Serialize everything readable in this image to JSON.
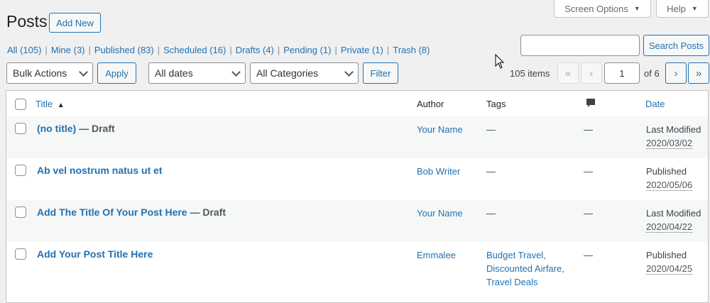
{
  "header": {
    "screen_options": "Screen Options",
    "help": "Help",
    "title": "Posts",
    "add_new": "Add New"
  },
  "filters": {
    "views": [
      {
        "label": "All",
        "count": "(105)"
      },
      {
        "label": "Mine",
        "count": "(3)"
      },
      {
        "label": "Published",
        "count": "(83)"
      },
      {
        "label": "Scheduled",
        "count": "(16)"
      },
      {
        "label": "Drafts",
        "count": "(4)"
      },
      {
        "label": "Pending",
        "count": "(1)"
      },
      {
        "label": "Private",
        "count": "(1)"
      },
      {
        "label": "Trash",
        "count": "(8)"
      }
    ],
    "bulk_actions": "Bulk Actions",
    "apply": "Apply",
    "dates": "All dates",
    "categories": "All Categories",
    "filter": "Filter"
  },
  "search": {
    "value": "",
    "button": "Search Posts"
  },
  "pagination": {
    "items": "105 items",
    "first": "«",
    "prev": "‹",
    "current": "1",
    "of": "of 6",
    "next": "›",
    "last": "»"
  },
  "table": {
    "columns": {
      "title": "Title",
      "sort_indicator": "▲",
      "author": "Author",
      "tags": "Tags",
      "date": "Date"
    },
    "icons": {
      "comments": "comment-bubble-icon"
    },
    "rows": [
      {
        "title": "(no title)",
        "state": " — Draft",
        "author": "Your Name",
        "tags": [
          "—"
        ],
        "comments": "—",
        "status": "Last Modified",
        "date": "2020/03/02"
      },
      {
        "title": "Ab vel nostrum natus ut et",
        "state": "",
        "author": "Bob Writer",
        "tags": [
          "—"
        ],
        "comments": "—",
        "status": "Published",
        "date": "2020/05/06"
      },
      {
        "title": "Add The Title Of Your Post Here",
        "state": " — Draft",
        "author": "Your Name",
        "tags": [
          "—"
        ],
        "comments": "—",
        "status": "Last Modified",
        "date": "2020/04/22"
      },
      {
        "title": "Add Your Post Title Here",
        "state": "",
        "author": "Emmalee",
        "tags": [
          "Budget Travel,",
          "Discounted Airfare,",
          "Travel Deals"
        ],
        "comments": "—",
        "status": "Published",
        "date": "2020/04/25"
      }
    ]
  }
}
